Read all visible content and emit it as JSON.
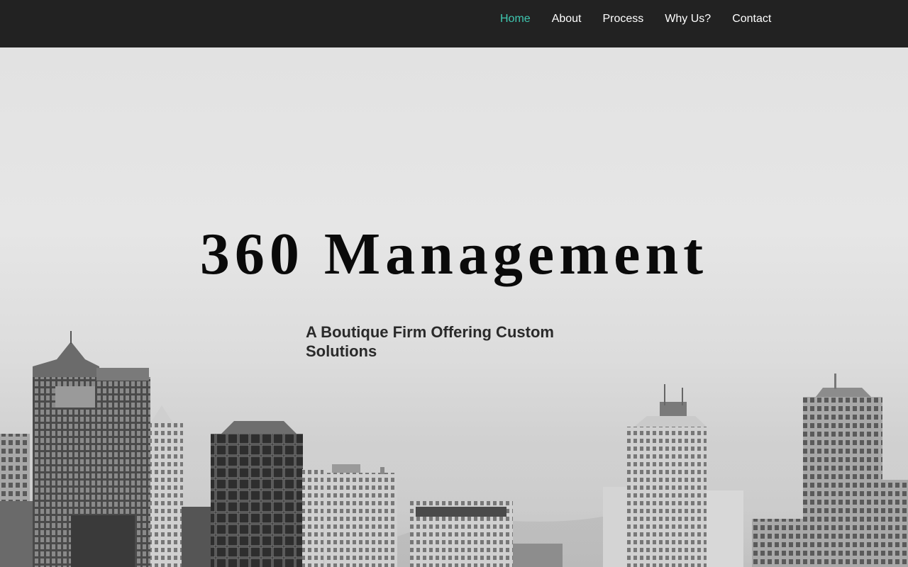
{
  "nav": {
    "items": [
      {
        "label": "Home",
        "active": true
      },
      {
        "label": "About",
        "active": false
      },
      {
        "label": "Process",
        "active": false
      },
      {
        "label": "Why Us?",
        "active": false
      },
      {
        "label": "Contact",
        "active": false
      }
    ],
    "active_color": "#3fc7b0",
    "background": "#222222"
  },
  "hero": {
    "title": "360 Management",
    "subtitle": "A Boutique Firm Offering Custom Solutions",
    "background_image": "grayscale-city-skyline"
  }
}
